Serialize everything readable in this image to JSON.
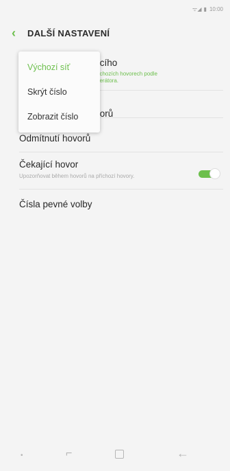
{
  "status_bar": {
    "signal": "ᯤ ◢",
    "battery": "▮",
    "time": "10:00"
  },
  "header": {
    "title": "DALŠÍ NASTAVENÍ"
  },
  "list": {
    "row1": {
      "title": "jícího",
      "subtitle": "dchozích hovorech podle\nperátora."
    },
    "row2": {
      "title": "vorů"
    },
    "row3": {
      "title": "Odmítnutí hovorů"
    },
    "row4": {
      "title": "Čekající hovor",
      "subtitle": "Upozorňovat během hovorů na příchozí hovory.",
      "toggle_on": true
    },
    "row5": {
      "title": "Čísla pevné volby"
    }
  },
  "popup": {
    "options": [
      "Výchozí síť",
      "Skrýt číslo",
      "Zobrazit číslo"
    ],
    "selected_index": 0
  },
  "colors": {
    "accent": "#6cbf4c",
    "background": "#f4f4f4"
  }
}
